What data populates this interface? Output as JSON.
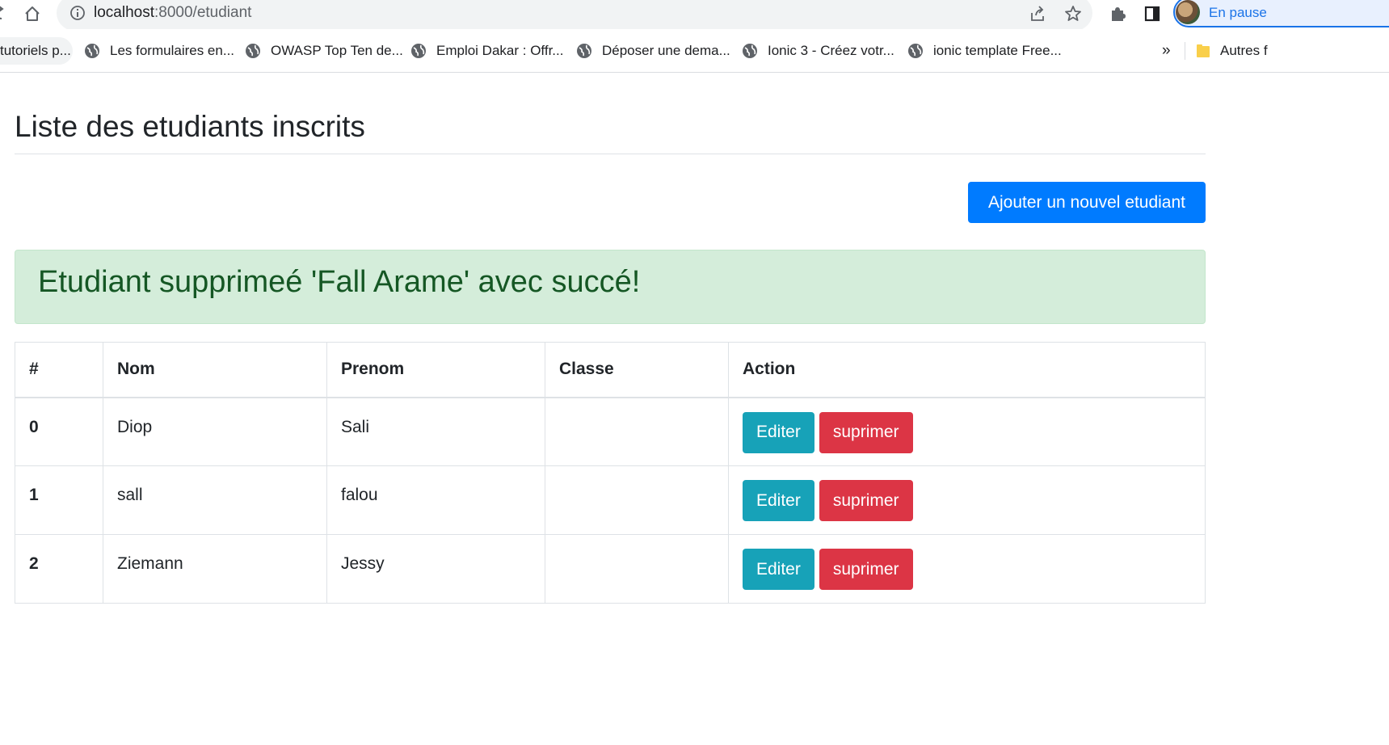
{
  "browser": {
    "url_host": "localhost",
    "url_path": ":8000/etudiant",
    "profile_status": "En pause",
    "bookmarks": [
      "tutoriels p...",
      "Les formulaires en...",
      "OWASP Top Ten de...",
      "Emploi Dakar : Offr...",
      "Déposer une dema...",
      "Ionic 3 - Créez votr...",
      "ionic template Free..."
    ],
    "more_label": "»",
    "other_bookmarks": "Autres f"
  },
  "page": {
    "title": "Liste des etudiants inscrits",
    "add_button": "Ajouter un nouvel etudiant",
    "alert": "Etudiant supprimeé 'Fall Arame' avec succé!"
  },
  "table": {
    "headers": [
      "#",
      "Nom",
      "Prenom",
      "Classe",
      "Action"
    ],
    "rows": [
      {
        "index": "0",
        "nom": "Diop",
        "prenom": "Sali",
        "classe": "",
        "edit": "Editer",
        "delete": "suprimer"
      },
      {
        "index": "1",
        "nom": "sall",
        "prenom": "falou",
        "classe": "",
        "edit": "Editer",
        "delete": "suprimer"
      },
      {
        "index": "2",
        "nom": "Ziemann",
        "prenom": "Jessy",
        "classe": "",
        "edit": "Editer",
        "delete": "suprimer"
      }
    ]
  },
  "colors": {
    "primary": "#007bff",
    "info": "#17a2b8",
    "danger": "#dc3545",
    "alert_bg": "#d4edda",
    "alert_text": "#155724"
  }
}
